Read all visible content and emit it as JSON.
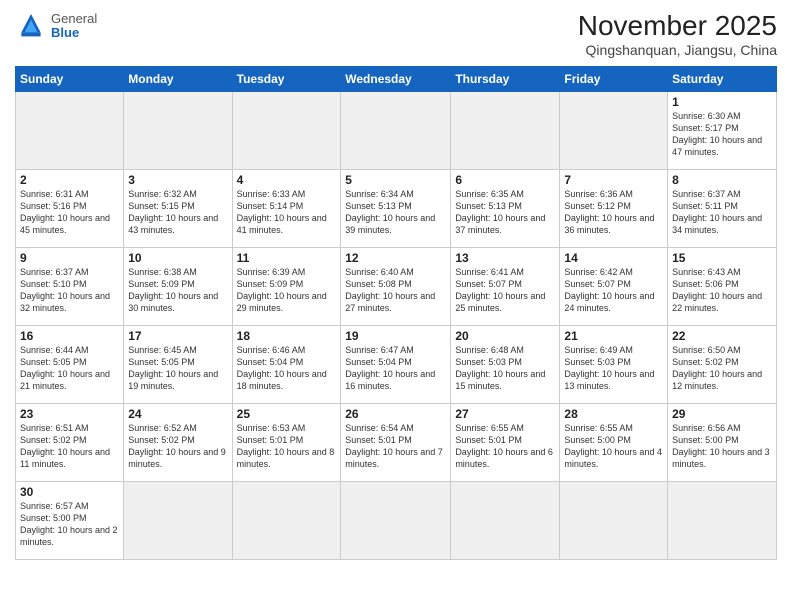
{
  "header": {
    "logo": {
      "general": "General",
      "blue": "Blue"
    },
    "title": "November 2025",
    "location": "Qingshanquan, Jiangsu, China"
  },
  "weekdays": [
    "Sunday",
    "Monday",
    "Tuesday",
    "Wednesday",
    "Thursday",
    "Friday",
    "Saturday"
  ],
  "weeks": [
    [
      {
        "day": "",
        "empty": true
      },
      {
        "day": "",
        "empty": true
      },
      {
        "day": "",
        "empty": true
      },
      {
        "day": "",
        "empty": true
      },
      {
        "day": "",
        "empty": true
      },
      {
        "day": "",
        "empty": true
      },
      {
        "day": "1",
        "sunrise": "6:30 AM",
        "sunset": "5:17 PM",
        "daylight": "10 hours and 47 minutes."
      }
    ],
    [
      {
        "day": "2",
        "sunrise": "6:31 AM",
        "sunset": "5:16 PM",
        "daylight": "10 hours and 45 minutes."
      },
      {
        "day": "3",
        "sunrise": "6:32 AM",
        "sunset": "5:15 PM",
        "daylight": "10 hours and 43 minutes."
      },
      {
        "day": "4",
        "sunrise": "6:33 AM",
        "sunset": "5:14 PM",
        "daylight": "10 hours and 41 minutes."
      },
      {
        "day": "5",
        "sunrise": "6:34 AM",
        "sunset": "5:13 PM",
        "daylight": "10 hours and 39 minutes."
      },
      {
        "day": "6",
        "sunrise": "6:35 AM",
        "sunset": "5:13 PM",
        "daylight": "10 hours and 37 minutes."
      },
      {
        "day": "7",
        "sunrise": "6:36 AM",
        "sunset": "5:12 PM",
        "daylight": "10 hours and 36 minutes."
      },
      {
        "day": "8",
        "sunrise": "6:37 AM",
        "sunset": "5:11 PM",
        "daylight": "10 hours and 34 minutes."
      }
    ],
    [
      {
        "day": "9",
        "sunrise": "6:37 AM",
        "sunset": "5:10 PM",
        "daylight": "10 hours and 32 minutes."
      },
      {
        "day": "10",
        "sunrise": "6:38 AM",
        "sunset": "5:09 PM",
        "daylight": "10 hours and 30 minutes."
      },
      {
        "day": "11",
        "sunrise": "6:39 AM",
        "sunset": "5:09 PM",
        "daylight": "10 hours and 29 minutes."
      },
      {
        "day": "12",
        "sunrise": "6:40 AM",
        "sunset": "5:08 PM",
        "daylight": "10 hours and 27 minutes."
      },
      {
        "day": "13",
        "sunrise": "6:41 AM",
        "sunset": "5:07 PM",
        "daylight": "10 hours and 25 minutes."
      },
      {
        "day": "14",
        "sunrise": "6:42 AM",
        "sunset": "5:07 PM",
        "daylight": "10 hours and 24 minutes."
      },
      {
        "day": "15",
        "sunrise": "6:43 AM",
        "sunset": "5:06 PM",
        "daylight": "10 hours and 22 minutes."
      }
    ],
    [
      {
        "day": "16",
        "sunrise": "6:44 AM",
        "sunset": "5:05 PM",
        "daylight": "10 hours and 21 minutes."
      },
      {
        "day": "17",
        "sunrise": "6:45 AM",
        "sunset": "5:05 PM",
        "daylight": "10 hours and 19 minutes."
      },
      {
        "day": "18",
        "sunrise": "6:46 AM",
        "sunset": "5:04 PM",
        "daylight": "10 hours and 18 minutes."
      },
      {
        "day": "19",
        "sunrise": "6:47 AM",
        "sunset": "5:04 PM",
        "daylight": "10 hours and 16 minutes."
      },
      {
        "day": "20",
        "sunrise": "6:48 AM",
        "sunset": "5:03 PM",
        "daylight": "10 hours and 15 minutes."
      },
      {
        "day": "21",
        "sunrise": "6:49 AM",
        "sunset": "5:03 PM",
        "daylight": "10 hours and 13 minutes."
      },
      {
        "day": "22",
        "sunrise": "6:50 AM",
        "sunset": "5:02 PM",
        "daylight": "10 hours and 12 minutes."
      }
    ],
    [
      {
        "day": "23",
        "sunrise": "6:51 AM",
        "sunset": "5:02 PM",
        "daylight": "10 hours and 11 minutes."
      },
      {
        "day": "24",
        "sunrise": "6:52 AM",
        "sunset": "5:02 PM",
        "daylight": "10 hours and 9 minutes."
      },
      {
        "day": "25",
        "sunrise": "6:53 AM",
        "sunset": "5:01 PM",
        "daylight": "10 hours and 8 minutes."
      },
      {
        "day": "26",
        "sunrise": "6:54 AM",
        "sunset": "5:01 PM",
        "daylight": "10 hours and 7 minutes."
      },
      {
        "day": "27",
        "sunrise": "6:55 AM",
        "sunset": "5:01 PM",
        "daylight": "10 hours and 6 minutes."
      },
      {
        "day": "28",
        "sunrise": "6:55 AM",
        "sunset": "5:00 PM",
        "daylight": "10 hours and 4 minutes."
      },
      {
        "day": "29",
        "sunrise": "6:56 AM",
        "sunset": "5:00 PM",
        "daylight": "10 hours and 3 minutes."
      }
    ],
    [
      {
        "day": "30",
        "sunrise": "6:57 AM",
        "sunset": "5:00 PM",
        "daylight": "10 hours and 2 minutes."
      },
      {
        "day": "",
        "empty": true
      },
      {
        "day": "",
        "empty": true
      },
      {
        "day": "",
        "empty": true
      },
      {
        "day": "",
        "empty": true
      },
      {
        "day": "",
        "empty": true
      },
      {
        "day": "",
        "empty": true
      }
    ]
  ],
  "labels": {
    "sunrise": "Sunrise:",
    "sunset": "Sunset:",
    "daylight": "Daylight:"
  }
}
